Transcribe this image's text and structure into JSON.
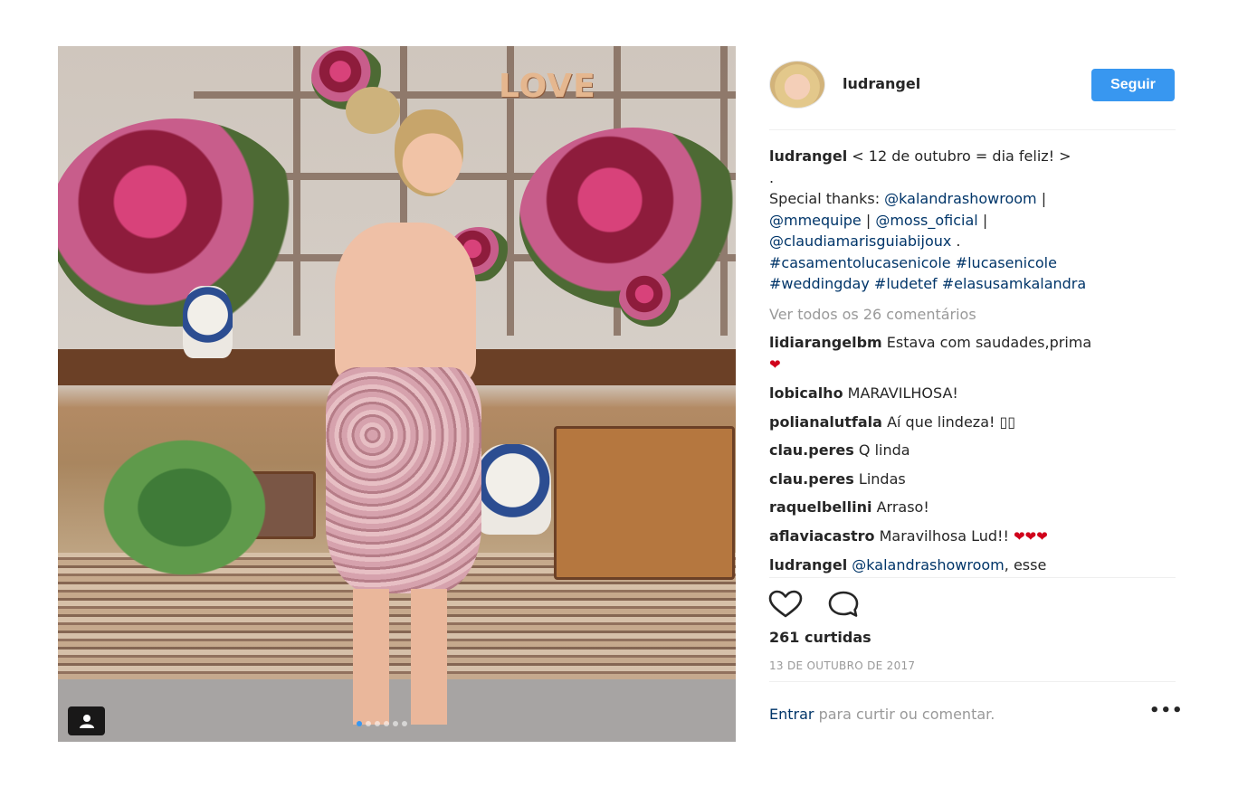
{
  "photo": {
    "sign_text": "LOVE",
    "carousel": {
      "total": 6,
      "active": 1
    }
  },
  "post": {
    "author": "ludrangel",
    "follow_label": "Seguir",
    "caption": {
      "username": "ludrangel",
      "text_1": "< 12 de outubro = dia feliz! >",
      "text_2": ".",
      "text_3": "Special thanks: ",
      "mention_1": "@kalandrashowroom",
      "sep_1": " |",
      "mention_2": "@mmequipe",
      "sep_2": " | ",
      "mention_3": "@moss_oficial",
      "sep_3": " |",
      "mention_4": "@claudiamarisguiabijoux",
      "sep_4": " .",
      "tag_1": "#casamentolucasenicole",
      "tag_2": "#lucasenicole",
      "tag_3": "#weddingday",
      "tag_4": "#ludetef",
      "tag_5": "#elasusamkalandra"
    },
    "view_all": "Ver todos os 26 comentários",
    "comments": [
      {
        "user": "lidiarangelbm",
        "text": "Estava com saudades,prima",
        "extra": "❤"
      },
      {
        "user": "lobicalho",
        "text": "MARAVILHOSA!"
      },
      {
        "user": "polianalutfala",
        "text": "Aí que lindeza! ▯▯"
      },
      {
        "user": "clau.peres",
        "text": "Q linda"
      },
      {
        "user": "clau.peres",
        "text": "Lindas"
      },
      {
        "user": "raquelbellini",
        "text": "Arraso!"
      },
      {
        "user": "aflaviacastro",
        "text": "Maravilhosa Lud!!",
        "extra": "❤❤❤"
      },
      {
        "user": "ludrangel",
        "mention": "@kalandrashowroom",
        "text": ", esse"
      }
    ],
    "likes": "261 curtidas",
    "date": "13 DE OUTUBRO DE 2017",
    "login_link": "Entrar",
    "login_text": " para curtir ou comentar.",
    "more": "•••"
  },
  "colors": {
    "accent": "#3897f0",
    "link": "#003569",
    "muted": "#999999",
    "heart": "#d0021b"
  },
  "icons": [
    "user-tag-icon",
    "heart-icon",
    "comment-icon",
    "more-options-icon"
  ]
}
